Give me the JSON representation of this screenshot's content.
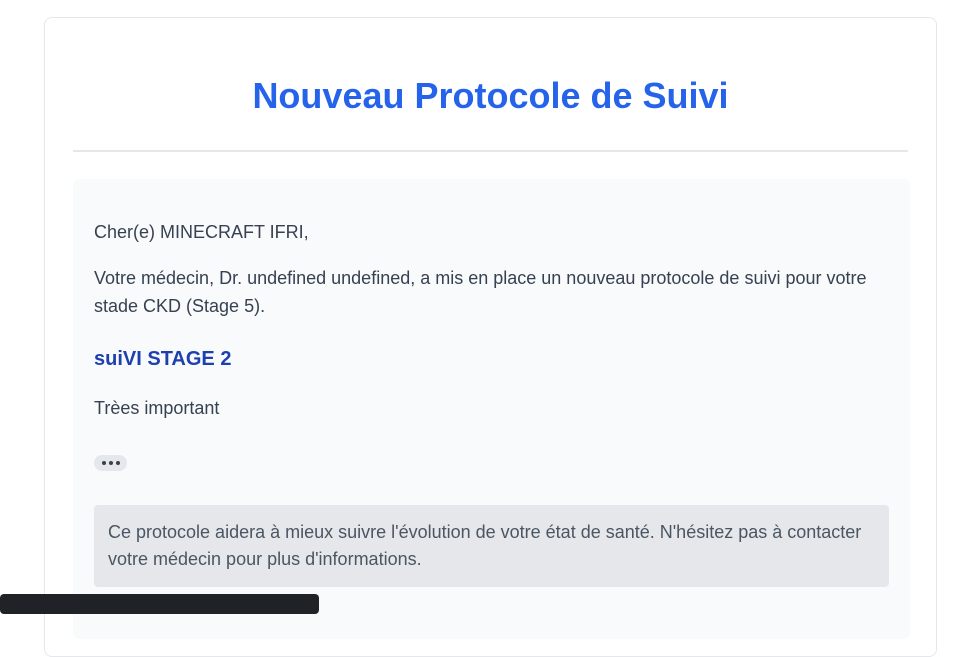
{
  "email": {
    "title": "Nouveau Protocole de Suivi",
    "greeting": "Cher(e) MINECRAFT IFRI,",
    "intro": "Votre médecin, Dr. undefined undefined, a mis en place un nouveau protocole de suivi pour votre stade CKD (Stage 5).",
    "protocol_title": "suiVI STAGE 2",
    "description": "Trèes important",
    "more_icon": "ellipsis-icon",
    "notice": "Ce protocole aidera à mieux suivre l'évolution de votre état de santé. N'hésitez pas à contacter votre médecin pour plus d'informations."
  },
  "colors": {
    "title": "#2563eb",
    "protocol_title": "#1e40af",
    "content_bg": "#f8fafc",
    "notice_bg": "#e5e7eb",
    "text": "#374151"
  }
}
